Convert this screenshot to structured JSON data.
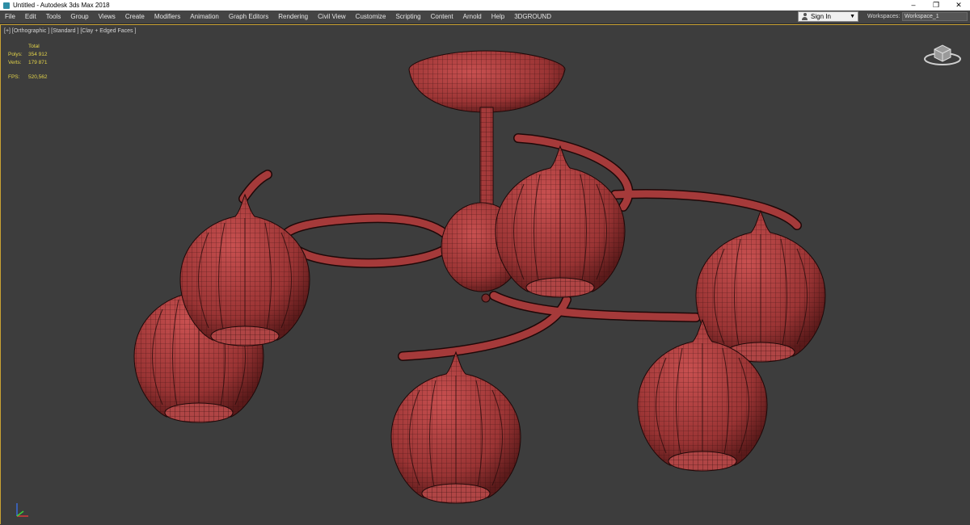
{
  "window": {
    "title": "Untitled - Autodesk 3ds Max 2018",
    "controls": {
      "minimize": "–",
      "restore": "❐",
      "close": "✕"
    }
  },
  "menu": [
    "File",
    "Edit",
    "Tools",
    "Group",
    "Views",
    "Create",
    "Modifiers",
    "Animation",
    "Graph Editors",
    "Rendering",
    "Civil View",
    "Customize",
    "Scripting",
    "Content",
    "Arnold",
    "Help",
    "3DGROUND"
  ],
  "signin": {
    "label": "Sign In"
  },
  "workspaces": {
    "label": "Workspaces:",
    "value": "Workspace_1"
  },
  "viewport": {
    "label": "[+] [Orthographic ] [Standard ] [Clay + Edged Faces ]",
    "stats": {
      "header": "Total",
      "polys_label": "Polys:",
      "polys_value": "354 912",
      "verts_label": "Verts:",
      "verts_value": "179 871",
      "fps_label": "FPS:",
      "fps_value": "520,562"
    }
  },
  "colors": {
    "mesh": "#a53a3a",
    "mesh_edge": "#2b0c0c",
    "viewport_bg": "#3d3d3d",
    "stats_text": "#e4d44a",
    "active_border": "#c9a233"
  }
}
